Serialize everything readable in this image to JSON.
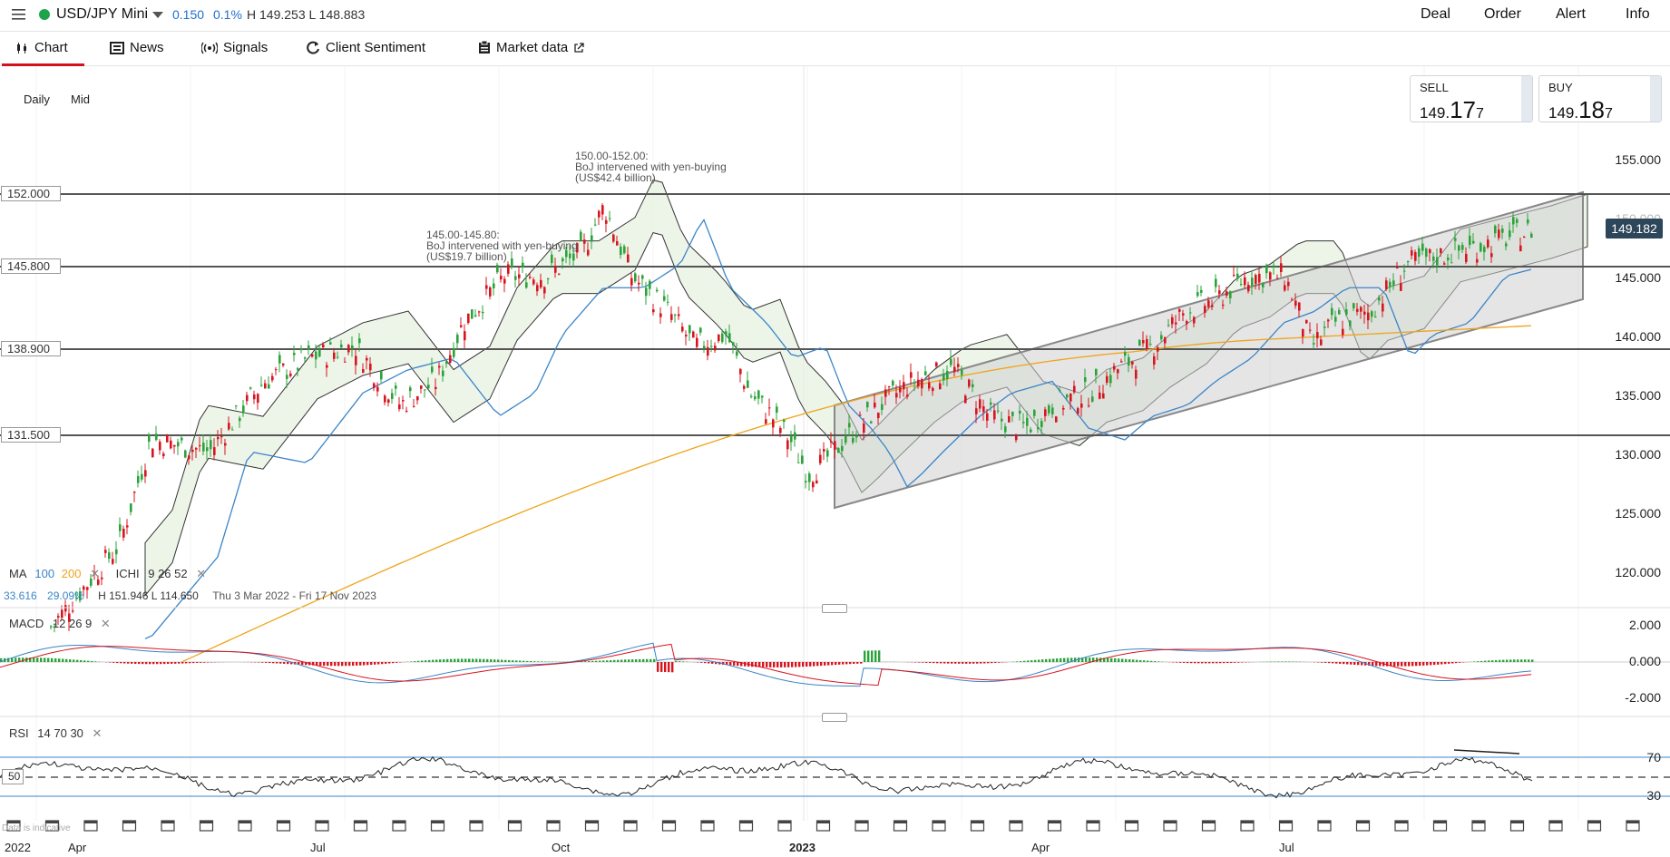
{
  "header": {
    "instrument": "USD/JPY Mini",
    "change": "0.150",
    "change_pct": "0.1%",
    "high_low": "H 149.253  L 148.883",
    "actions": [
      "Deal",
      "Order",
      "Alert",
      "Info"
    ]
  },
  "tabs": [
    {
      "label": "Chart",
      "icon": "candles-icon"
    },
    {
      "label": "News",
      "icon": "newspaper-icon"
    },
    {
      "label": "Signals",
      "icon": "broadcast-icon"
    },
    {
      "label": "Client Sentiment",
      "icon": "refresh-icon"
    },
    {
      "label": "Market data",
      "icon": "clipboard-icon"
    }
  ],
  "chart_controls": {
    "interval": "Daily",
    "price_type": "Mid"
  },
  "quote": {
    "sell_label": "SELL",
    "sell_prefix": "149.",
    "sell_big": "17",
    "sell_small": "7",
    "buy_label": "BUY",
    "buy_prefix": "149.",
    "buy_big": "18",
    "buy_small": "7"
  },
  "current_price": "149.182",
  "levels": [
    "152.000",
    "145.800",
    "138.900",
    "131.500"
  ],
  "price_axis": [
    "155.000",
    "150.000",
    "145.000",
    "140.000",
    "135.000",
    "130.000",
    "125.000",
    "120.000"
  ],
  "annotations": {
    "boj1": [
      "150.00-152.00:",
      "BoJ intervened with yen-buying",
      "(US$42.4 billion)"
    ],
    "boj2": [
      "145.00-145.80:",
      "BoJ intervened with yen-buying",
      "(US$19.7 billion)"
    ]
  },
  "legend": {
    "ma_label": "MA",
    "ma_100": "100",
    "ma_200": "200",
    "ichi_label": "ICHI",
    "ichi_params": "9   26   52",
    "stats_a": "33.616",
    "stats_b": "29.09%",
    "stats_hl": "H 151.946   L 114.650",
    "range": "Thu 3 Mar 2022 - Fri 17 Nov 2023"
  },
  "macd": {
    "label": "MACD",
    "params": "12   26   9",
    "axis": [
      "2.000",
      "0.000",
      "-2.000"
    ]
  },
  "rsi": {
    "label": "RSI",
    "params": "14   70   30",
    "axis": [
      "70",
      "30"
    ],
    "mid": "50"
  },
  "x_axis": [
    "2022",
    "Apr",
    "Jul",
    "Oct",
    "2023",
    "Apr",
    "Jul"
  ],
  "watermark": "Data is indicative",
  "colors": {
    "up": "#2aa33a",
    "down": "#d8141f",
    "ma100": "#3a85c8",
    "ma200": "#f0a319",
    "accent": "#d3131b"
  }
}
